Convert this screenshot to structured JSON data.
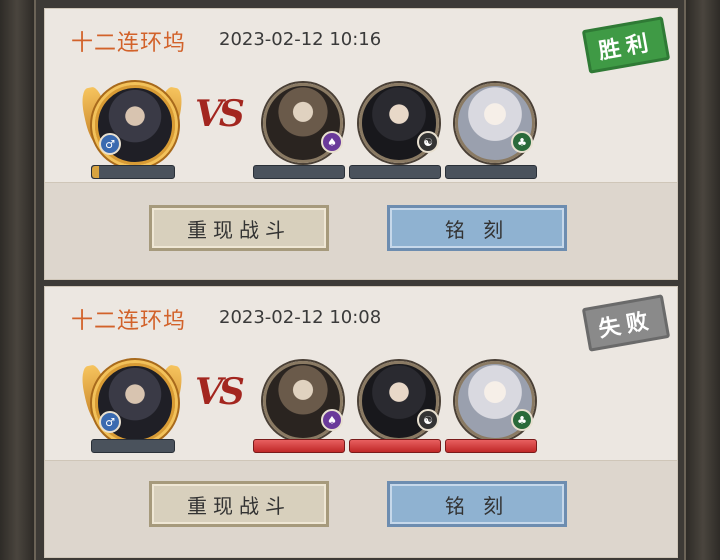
{
  "battles": [
    {
      "title": "十二连环坞",
      "time": "2023-02-12 10:16",
      "result_label": "胜利",
      "result": "win",
      "vs_text": "VS",
      "player_progress": 0.08,
      "opponent_bars": "dark",
      "replay_label": "重现战斗",
      "engrave_label": "铭 刻"
    },
    {
      "title": "十二连环坞",
      "time": "2023-02-12 10:08",
      "result_label": "失败",
      "result": "loss",
      "vs_text": "VS",
      "player_progress": 0,
      "opponent_bars": "red",
      "replay_label": "重现战斗",
      "engrave_label": "铭 刻"
    }
  ],
  "badges": {
    "hero": "♂",
    "p1": "♠",
    "p2": "☯",
    "p3": "♣"
  },
  "colors": {
    "title": "#d2622a",
    "win": "#3f9a45",
    "loss": "#8a8a8a",
    "vs": "#a3261f"
  }
}
